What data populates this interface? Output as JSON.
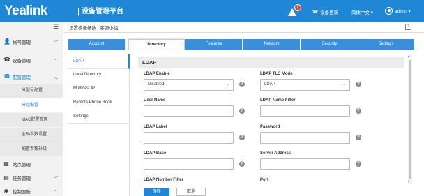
{
  "header": {
    "brand": "Yealink",
    "separator": "|",
    "platform_title": "设备管理平台",
    "alarm_count": "4",
    "update_label": "设备更新",
    "language": "简体中文 ▾",
    "user": "admin ▾"
  },
  "sidebar": {
    "menus": [
      {
        "label": "帐号管理",
        "icon": "person-icon"
      },
      {
        "label": "设备管理",
        "icon": "phone-icon"
      },
      {
        "label": "配置管理",
        "icon": "config-icon"
      }
    ],
    "sub_items": [
      "分型号配置",
      "分组配置",
      "MAC配置管理",
      "全局参数设置",
      "配置参数升级"
    ],
    "menus_bottom": [
      {
        "label": "站点管理",
        "icon": "site-icon"
      },
      {
        "label": "任务管理",
        "icon": "task-icon"
      },
      {
        "label": "控制面板",
        "icon": "dashboard-icon"
      }
    ]
  },
  "breadcrumb": "设置模板参数 | 客服小组",
  "tabs": [
    "Account",
    "Directory",
    "Features",
    "Network",
    "Security",
    "Settings"
  ],
  "active_tab": "Directory",
  "subnav": [
    "LDAP",
    "Local Directory",
    "Multicast IP",
    "Remote Phone Book",
    "Settings"
  ],
  "panel": {
    "title": "LDAP",
    "fields": {
      "ldap_enable": {
        "label": "LDAP Enable",
        "value": "Disabled"
      },
      "ldap_tls_mode": {
        "label": "LDAP TLS Mode",
        "value": "LDAP"
      },
      "user_name": {
        "label": "User Name",
        "value": ""
      },
      "ldap_name_filter": {
        "label": "LDAP Name Filter",
        "value": ""
      },
      "ldap_label": {
        "label": "LDAP Label",
        "value": ""
      },
      "password": {
        "label": "Password",
        "value": ""
      },
      "ldap_base": {
        "label": "LDAP Base",
        "value": ""
      },
      "server_address": {
        "label": "Server Address",
        "value": ""
      },
      "ldap_number_filter": {
        "label": "LDAP Number Filter"
      },
      "port": {
        "label": "Port"
      }
    }
  },
  "buttons": {
    "save": "保存",
    "cancel": "取消"
  },
  "colors": {
    "brand_blue": "#1f87d6",
    "tab_blue": "#3b8fd9",
    "badge_red": "#e8433a"
  }
}
